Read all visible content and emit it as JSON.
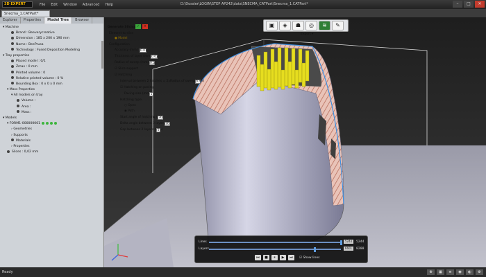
{
  "app": {
    "logo": "3D EXPERT",
    "window_title": "D:\\Dossier\\LOGIN\\STEP AP242\\data\\SNECMA_CATPart\\Snecma_1.CATPart*"
  },
  "menu": [
    "File",
    "Edit",
    "Window",
    "Advanced",
    "Help"
  ],
  "doc_tab": "Snecma_1.CATPart*",
  "panel_tabs": [
    "Explorer",
    "Properties",
    "Model Tree",
    "Browser"
  ],
  "tree": {
    "machine": "Machine",
    "brand": "Brand : Beeverycreative",
    "dimension": "Dimension : 185 x 200 x 190 mm",
    "name": "Name : BeePrusa",
    "technology": "Technology : Fused Deposition Modeling",
    "tray": "Tray properties",
    "placed": "Placed model : 0/1",
    "zmax": "Zmax : 0 mm",
    "printed_volume": "Printed volume : 0",
    "relative_volume": "Relative printed volume : 0 %",
    "bbox": "Bounding Box : 0 x 0 x 0 mm",
    "mass": "Mass Properties",
    "all_models": "All models on tray",
    "volume": "Volume :",
    "area": "Area :",
    "mass_val": "Mass :",
    "models": "Models",
    "form": "FORM1-000000001",
    "geometries": "Geometries",
    "supports": "Supports",
    "materials": "Materials",
    "properties": "Properties",
    "slices": "Slices : 0,02 mm"
  },
  "dialog": {
    "title": "Generate Slicing",
    "element": "Element to slice",
    "model": "Model",
    "configuration": "Configuration",
    "accuracy_label": "Accuracy (mm)",
    "accuracy": "0.01",
    "thickness_label": "Thickness of layer (mm)",
    "thickness": "0.02",
    "radius_label": "Radius of sweep (mm)",
    "radius": "0.2",
    "slice_support": "Slice support",
    "hatching": "Hatching",
    "interval_label": "Interval between 2 hatches = 2xRadius of sweep (mm)",
    "interval": "0.4",
    "hatching_paving": "Hatching on paving",
    "paving_label": "Paving size (mm)",
    "paving": "5",
    "hatching_type": "Hatching type",
    "open": "Open",
    "path": "Path",
    "start_angle_label": "Start angle of hatching (°)",
    "start_angle": "30",
    "delta_angle_label": "Delta angle between 2 layers (°)",
    "delta_angle": "30",
    "gap_label": "Gap between 2 layers (mm)",
    "gap": "0"
  },
  "toolbar_export": "Export",
  "player": {
    "lines_label": "Lines",
    "lines_value": "5244",
    "lines_max": "5244",
    "layers_label": "Layers",
    "layers_value": "6601",
    "layers_max": "8288",
    "lines_fraction": 1.0,
    "layers_fraction": 0.8,
    "show_lines": "Show lines"
  },
  "status": "Ready",
  "colors": {
    "accent_green": "#3db53d",
    "hatch": "#d9a59a",
    "pins": "#e8e01c",
    "body": "#c9c8de"
  }
}
